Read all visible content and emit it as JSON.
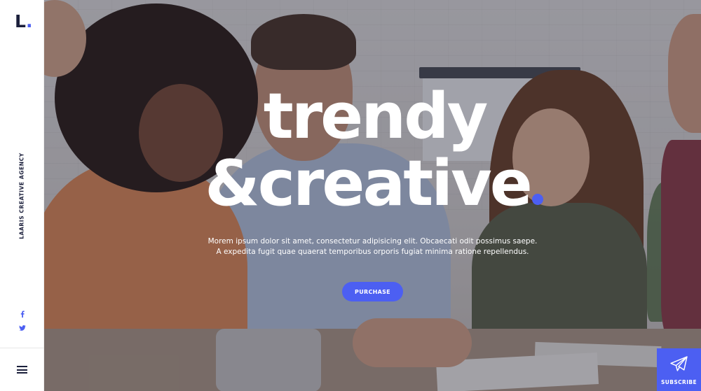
{
  "brand": {
    "logo_letter": "L",
    "logo_dot": ".",
    "tagline_vertical": "LAARIS CREATIVE AGENCY",
    "accent_color": "#4c5ff2"
  },
  "sidebar": {
    "social": [
      {
        "name": "facebook",
        "icon": "facebook-icon",
        "glyph": "f"
      },
      {
        "name": "twitter",
        "icon": "twitter-icon"
      }
    ],
    "menu_icon": "hamburger-menu-icon"
  },
  "hero": {
    "headline_line1": "trendy",
    "headline_line2": "&creative",
    "description_line1": "Morem ipsum dolor sit amet, consectetur adipisicing elit. Obcaecati odit possimus saepe.",
    "description_line2": "A expedita fugit quae quaerat temporibus orporis fugiat minima ratione repellendus.",
    "cta_label": "PURCHASE"
  },
  "subscribe": {
    "label": "SUBSCRIBE",
    "icon": "paper-plane-icon"
  }
}
